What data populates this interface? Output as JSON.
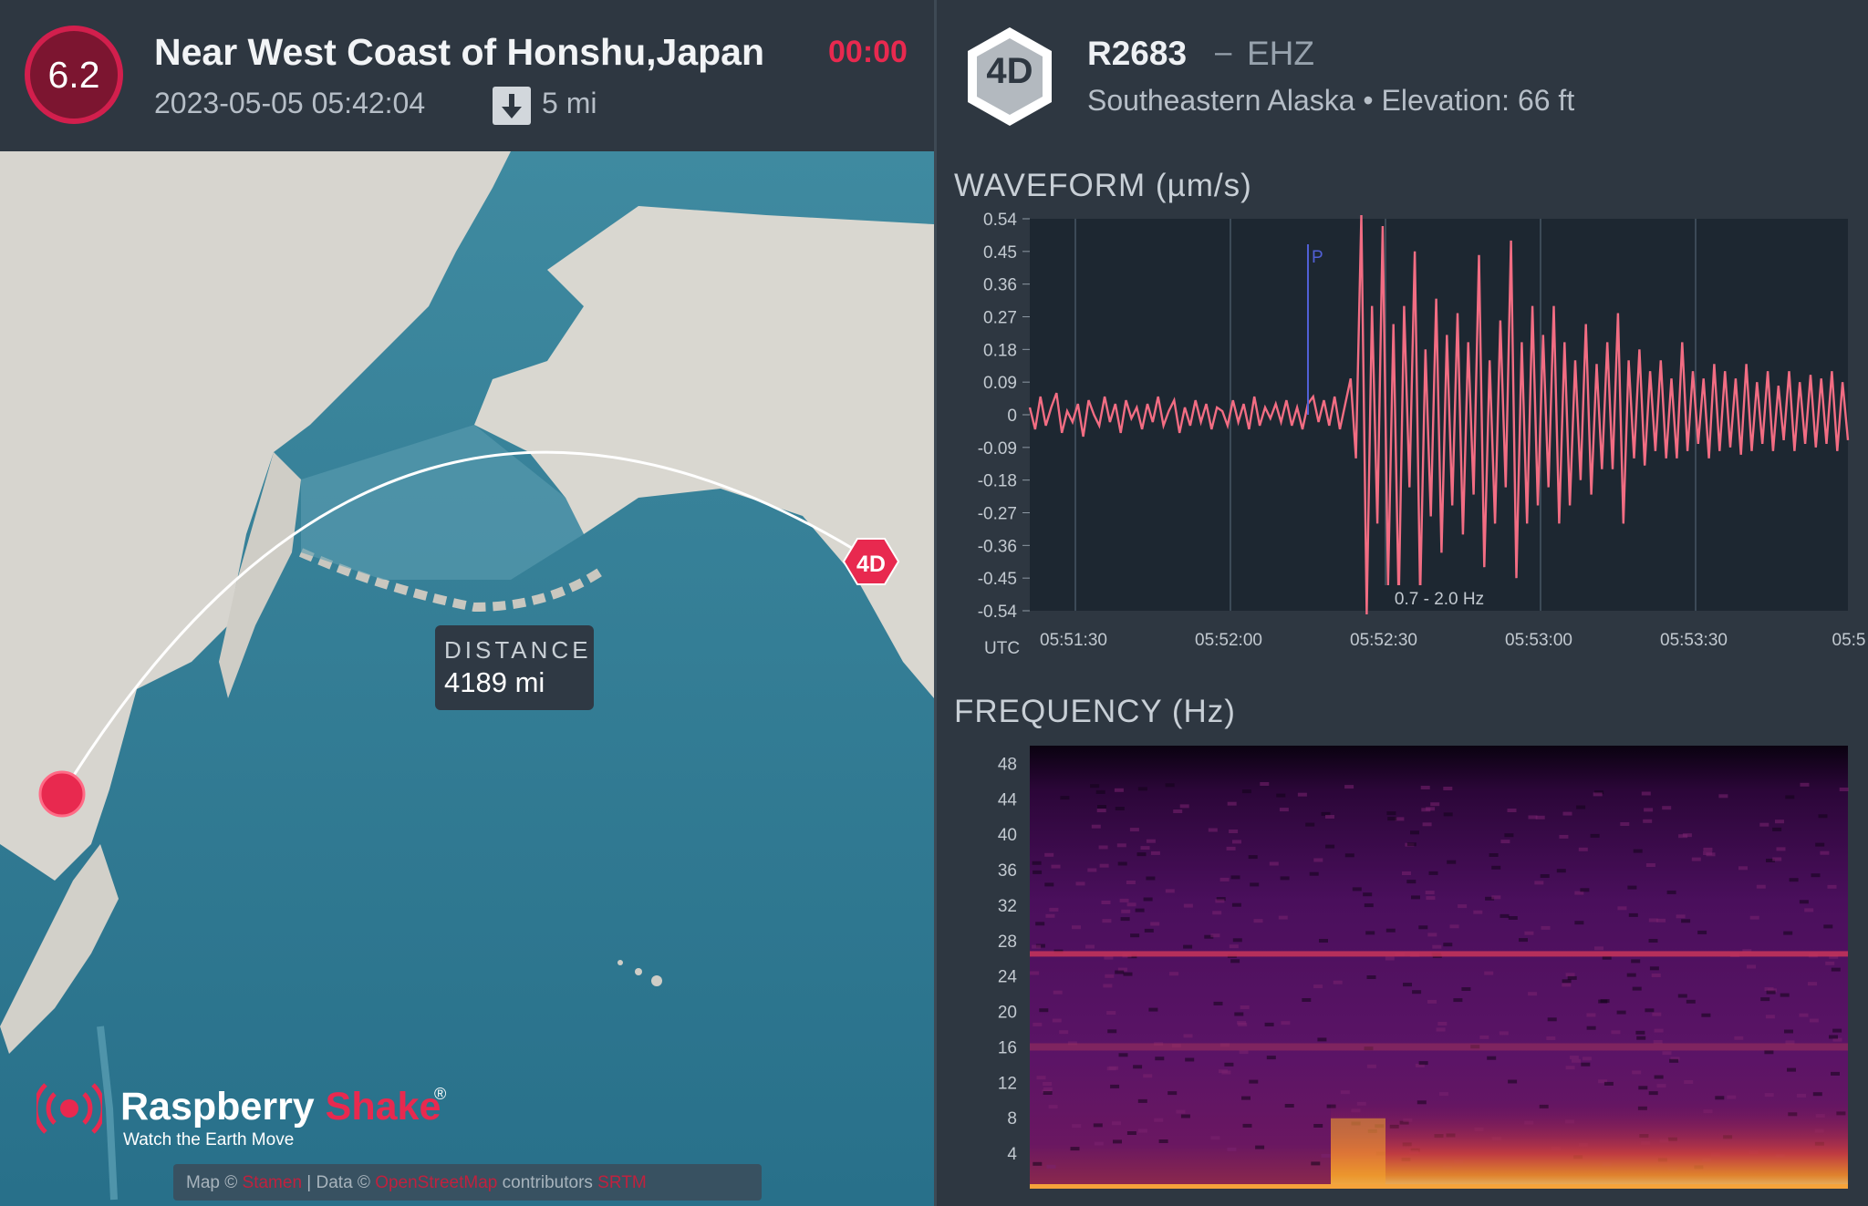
{
  "event": {
    "magnitude": "6.2",
    "title": "Near West Coast of Honshu,Japan",
    "timer": "00:00",
    "datetime": "2023-05-05 05:42:04",
    "depth": "5 mi"
  },
  "map": {
    "distance_label": "DISTANCE",
    "distance_value": "4189 mi",
    "station_marker": "4D",
    "logo_name_a": "Raspberry ",
    "logo_name_b": "Shake",
    "logo_reg": "®",
    "logo_tagline": "Watch the Earth Move",
    "attribution": {
      "map_prefix": "Map © ",
      "map_link": "Stamen",
      "data_prefix": " | Data © ",
      "data_link": "OpenStreetMap",
      "contrib": " contributors ",
      "srtm_link": "SRTM"
    }
  },
  "station": {
    "badge": "4D",
    "code": "R2683",
    "separator": "–",
    "channel": "EHZ",
    "location": "Southeastern Alaska • Elevation: 66 ft"
  },
  "colors": {
    "accent": "#e8294f",
    "waveform": "#f26d83",
    "panel": "#2e3741"
  },
  "chart_data": [
    {
      "type": "line",
      "title": "WAVEFORM (µm/s)",
      "x_unit_label": "UTC",
      "x_tick_labels": [
        "05:51:30",
        "05:52:00",
        "05:52:30",
        "05:53:00",
        "05:53:30",
        "05:5"
      ],
      "y_tick_labels": [
        "0.54",
        "0.45",
        "0.36",
        "0.27",
        "0.18",
        "0.09",
        "0",
        "-0.09",
        "-0.18",
        "-0.27",
        "-0.36",
        "-0.45",
        "-0.54"
      ],
      "ylim": [
        -0.54,
        0.54
      ],
      "grid": true,
      "phase_marker": {
        "label": "P",
        "time": "05:52:13"
      },
      "filter_label": "0.7 - 2.0 Hz",
      "series": [
        {
          "values": [
            0.02,
            -0.04,
            0.05,
            -0.03,
            0.02,
            0.06,
            -0.05,
            0.01,
            -0.02,
            0.03,
            -0.06,
            0.04,
            0.0,
            -0.03,
            0.05,
            -0.02,
            0.03,
            -0.05,
            0.04,
            -0.01,
            0.02,
            -0.04,
            0.03,
            -0.02,
            0.05,
            -0.03,
            0.01,
            0.04,
            -0.05,
            0.02,
            -0.03,
            0.04,
            -0.02,
            0.03,
            -0.04,
            0.02,
            0.01,
            -0.03,
            0.04,
            -0.02,
            0.03,
            -0.04,
            0.05,
            -0.03,
            0.02,
            -0.01,
            0.03,
            -0.02,
            0.04,
            -0.03,
            0.02,
            -0.04,
            0.03,
            0.05,
            -0.02,
            0.04,
            -0.03,
            0.05,
            -0.04,
            0.03,
            0.1,
            -0.12,
            0.55,
            -0.55,
            0.3,
            -0.3,
            0.52,
            -0.47,
            0.25,
            -0.52,
            0.3,
            -0.2,
            0.45,
            -0.5,
            0.18,
            -0.28,
            0.32,
            -0.38,
            0.22,
            -0.25,
            0.28,
            -0.33,
            0.2,
            -0.22,
            0.44,
            -0.42,
            0.15,
            -0.3,
            0.26,
            -0.2,
            0.48,
            -0.45,
            0.2,
            -0.3,
            0.3,
            -0.25,
            0.22,
            -0.2,
            0.3,
            -0.3,
            0.2,
            -0.25,
            0.15,
            -0.18,
            0.25,
            -0.22,
            0.14,
            -0.15,
            0.2,
            -0.15,
            0.28,
            -0.3,
            0.15,
            -0.12,
            0.18,
            -0.14,
            0.12,
            -0.1,
            0.15,
            -0.12,
            0.1,
            -0.12,
            0.2,
            -0.1,
            0.12,
            -0.08,
            0.1,
            -0.12,
            0.14,
            -0.1,
            0.12,
            -0.09,
            0.1,
            -0.11,
            0.14,
            -0.1,
            0.09,
            -0.08,
            0.12,
            -0.1,
            0.08,
            -0.07,
            0.12,
            -0.1,
            0.09,
            -0.08,
            0.11,
            -0.09,
            0.1,
            -0.08,
            0.12,
            -0.1,
            0.09,
            -0.07
          ]
        }
      ]
    },
    {
      "type": "heatmap",
      "title": "FREQUENCY (Hz)",
      "y_tick_labels": [
        "48",
        "44",
        "40",
        "36",
        "32",
        "28",
        "24",
        "20",
        "16",
        "12",
        "8",
        "4"
      ],
      "ylim": [
        0,
        50
      ],
      "notable_bands_hz": [
        26.5,
        16
      ],
      "energy_burst": {
        "start": "05:52:30",
        "freq_max_hz": 10
      }
    }
  ]
}
